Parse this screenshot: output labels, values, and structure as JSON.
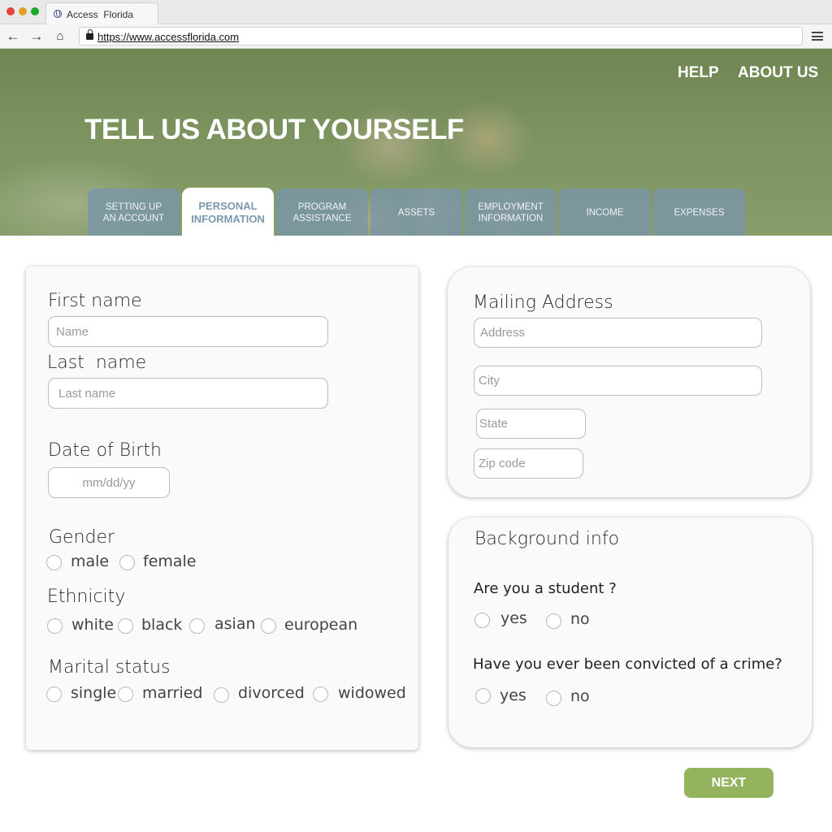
{
  "browser": {
    "tab_title": "Access  Florida",
    "url": "https://www.accessflorida.com",
    "icons": [
      "globe-icon",
      "back-arrow-icon",
      "forward-arrow-icon",
      "home-icon",
      "lock-icon",
      "menu-icon"
    ]
  },
  "header": {
    "help": "HELP",
    "about": "ABOUT US",
    "title": "TELL US ABOUT YOURSELF"
  },
  "steps": {
    "items": [
      {
        "line1": "SETTING UP",
        "line2": "AN ACCOUNT"
      },
      {
        "line1": "PERSONAL",
        "line2": "INFORMATION"
      },
      {
        "line1": "PROGRAM",
        "line2": "ASSISTANCE"
      },
      {
        "line1": "ASSETS",
        "line2": ""
      },
      {
        "line1": "EMPLOYMENT",
        "line2": "INFORMATION"
      },
      {
        "line1": "INCOME",
        "line2": ""
      },
      {
        "line1": "EXPENSES",
        "line2": ""
      }
    ],
    "active_index": 1
  },
  "personal": {
    "first_name_label": "First name",
    "first_name_placeholder": "Name",
    "last_name_label": "Last  name",
    "last_name_placeholder": "Last name",
    "dob_label": "Date of Birth",
    "dob_placeholder": "mm/dd/yy",
    "gender_label": "Gender",
    "gender_options": [
      "male",
      "female"
    ],
    "ethnicity_label": "Ethnicity",
    "ethnicity_options": [
      "white",
      "black",
      "asian",
      "european"
    ],
    "marital_label": "Marital status",
    "marital_options": [
      "single",
      "married",
      "divorced",
      "widowed"
    ]
  },
  "mailing": {
    "title": "Mailing Address",
    "address_placeholder": "Address",
    "city_placeholder": "City",
    "state_placeholder": "State",
    "zip_placeholder": "Zip code"
  },
  "background": {
    "title": "Background info",
    "student_question": "Are you a student ?",
    "student_options": [
      "yes",
      "no"
    ],
    "crime_question": "Have you ever been convicted of a crime?",
    "crime_options": [
      "yes",
      "no"
    ]
  },
  "next_label": "NEXT",
  "colors": {
    "accent_green": "#93b35f",
    "tab_blue": "#7896aa",
    "active_tab_text": "#7c98ae"
  }
}
